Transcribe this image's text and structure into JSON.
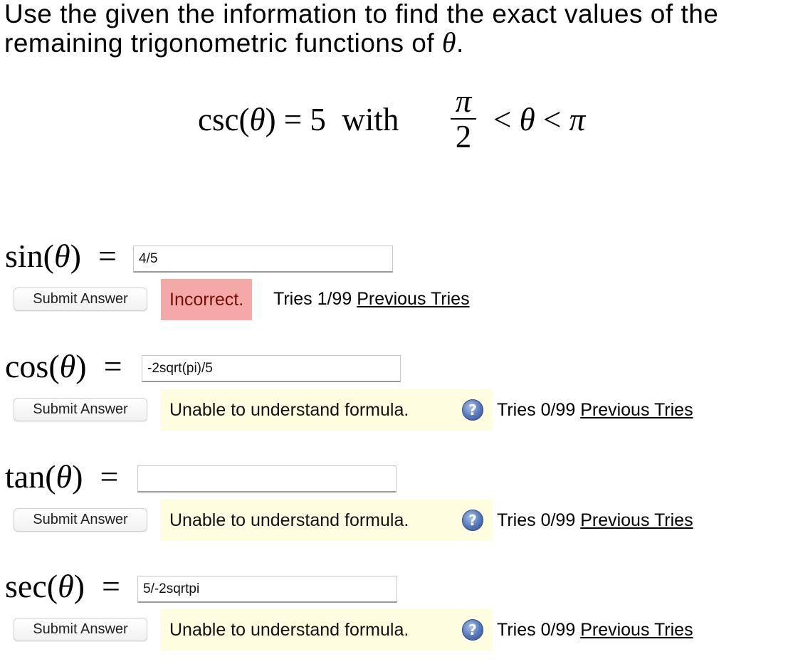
{
  "prompt": {
    "text_before": "Use the given the information to find the exact values of the remaining trigonometric functions of ",
    "theta": "θ",
    "text_after": "."
  },
  "given": {
    "lhs_fn": "csc(",
    "lhs_var": "θ",
    "lhs_close": ") = 5  with",
    "frac_num": "π",
    "frac_den": "2",
    "rhs_lt1": "<",
    "rhs_theta": "θ",
    "rhs_lt2": "<",
    "rhs_pi": "π"
  },
  "rows": [
    {
      "fn": "sin(",
      "var": "θ",
      "close": ")",
      "eq": "=",
      "value": "4/5",
      "submit_label": "Submit Answer",
      "feedback": "Incorrect.",
      "feedback_type": "incorrect",
      "tries": "Tries 1/99",
      "previous_tries": "Previous Tries"
    },
    {
      "fn": "cos(",
      "var": "θ",
      "close": ")",
      "eq": "=",
      "value": "-2sqrt(pi)/5",
      "submit_label": "Submit Answer",
      "feedback": "Unable to understand formula.",
      "feedback_type": "warn",
      "help_icon": "question-mark-help-icon",
      "help_glyph": "?",
      "tries": "Tries 0/99",
      "previous_tries": "Previous Tries"
    },
    {
      "fn": "tan(",
      "var": "θ",
      "close": ")",
      "eq": "=",
      "value": "",
      "submit_label": "Submit Answer",
      "feedback": "Unable to understand formula.",
      "feedback_type": "warn",
      "help_icon": "question-mark-help-icon",
      "help_glyph": "?",
      "tries": "Tries 0/99",
      "previous_tries": "Previous Tries"
    },
    {
      "fn": "sec(",
      "var": "θ",
      "close": ")",
      "eq": "=",
      "value": "5/-2sqrtpi",
      "submit_label": "Submit Answer",
      "feedback": "Unable to understand formula.",
      "feedback_type": "warn",
      "help_icon": "question-mark-help-icon",
      "help_glyph": "?",
      "tries": "Tries 0/99",
      "previous_tries": "Previous Tries"
    }
  ],
  "colors": {
    "incorrect_bg": "#f4a9a9",
    "incorrect_text": "#7a0c0c",
    "warn_bg": "#fffde0",
    "help_icon": "#5576b8"
  }
}
